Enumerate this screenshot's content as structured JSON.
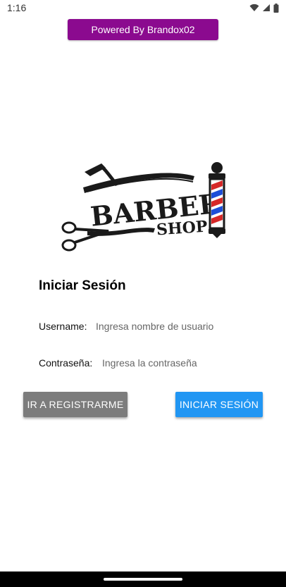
{
  "status_bar": {
    "time": "1:16",
    "icons": [
      "wifi-icon",
      "signal-icon",
      "battery-icon"
    ]
  },
  "banner": {
    "label": "Powered By Brandox02",
    "color": "#8b0a8f"
  },
  "logo": {
    "line1": "BARBER",
    "line2": "SHOP"
  },
  "login": {
    "title": "Iniciar Sesión",
    "username_label": "Username:",
    "username_placeholder": "Ingresa nombre de usuario",
    "password_label": "Contraseña:",
    "password_placeholder": "Ingresa la contraseña"
  },
  "buttons": {
    "register_label": "IR A REGISTRARME",
    "register_color": "#7c7c7c",
    "login_label": "INICIAR SESIÓN",
    "login_color": "#2196f3"
  }
}
